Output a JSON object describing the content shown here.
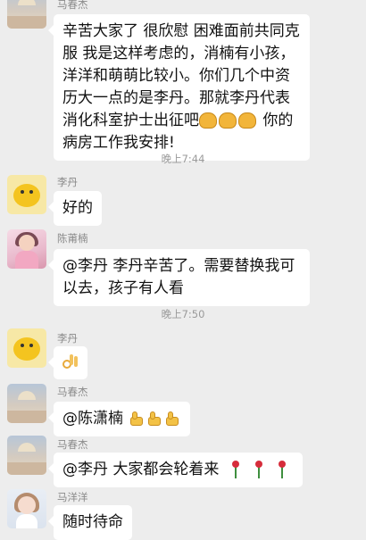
{
  "messages": {
    "m0": {
      "sender": "马春杰",
      "text": "辛苦大家了 很欣慰 困难面前共同克服 我是这样考虑的，消楠有小孩，洋洋和萌萌比较小。你们几个中资历大一点的是李丹。那就李丹代表消化科室护士出征吧",
      "text_after": " 你的病房工作我安排!"
    },
    "time1": "晚上7:44",
    "m1": {
      "sender": "李丹",
      "text": "好的"
    },
    "m2": {
      "sender": "陈莆楠",
      "text": "@李丹  李丹辛苦了。需要替换我可以去，孩子有人看"
    },
    "time2": "晚上7:50",
    "m3": {
      "sender": "李丹",
      "emoji": "ok-hand"
    },
    "m4": {
      "sender": "马春杰",
      "text": "@陈潇楠",
      "emoji": "thumbs-up x3"
    },
    "m5": {
      "sender": "马春杰",
      "text": "@李丹  大家都会轮着来",
      "emoji": "rose x3"
    },
    "m6": {
      "sender": "马洋洋",
      "text": "随时待命"
    }
  }
}
